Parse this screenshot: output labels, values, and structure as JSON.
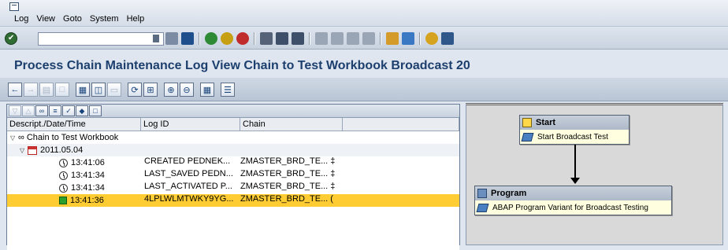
{
  "menu": [
    "Log",
    "View",
    "Goto",
    "System",
    "Help"
  ],
  "command_field": {
    "value": ""
  },
  "title": "Process Chain Maintenance Log View Chain to Test Workbook Broadcast 20",
  "table": {
    "headers": [
      "Descript./Date/Time",
      "Log ID",
      "Chain"
    ],
    "rows": [
      {
        "type": "chain",
        "c1": "Chain to Test Workbook",
        "c2": "",
        "c3": ""
      },
      {
        "type": "date",
        "c1": "2011.05.04",
        "c2": "",
        "c3": ""
      },
      {
        "type": "time",
        "c1": "13:41:06",
        "c2": "CREATED PEDNEK...",
        "c3": "ZMASTER_BRD_TE... ‡"
      },
      {
        "type": "time",
        "c1": "13:41:34",
        "c2": "LAST_SAVED PEDN...",
        "c3": "ZMASTER_BRD_TE... ‡"
      },
      {
        "type": "time",
        "c1": "13:41:34",
        "c2": "LAST_ACTIVATED P...",
        "c3": "ZMASTER_BRD_TE... ‡"
      },
      {
        "type": "selected",
        "c1": "13:41:36",
        "c2": "4LPLWLMTWKY9YG...",
        "c3": "ZMASTER_BRD_TE... ("
      }
    ]
  },
  "diagram": {
    "start": {
      "title": "Start",
      "label": "Start Broadcast Test"
    },
    "program": {
      "title": "Program",
      "label": "ABAP Program Variant for Broadcast Testing"
    }
  },
  "colors": {
    "title": "#1c3f6e",
    "selected_row": "#ffcc33",
    "node_body": "#ffffe0"
  },
  "icons": [
    "ok-icon",
    "save-icon",
    "back-icon",
    "exit-icon",
    "cancel-icon",
    "print-icon",
    "find-icon",
    "help-icon",
    "layout-icon",
    "chain-icon",
    "calendar-icon",
    "clock-icon",
    "status-green-icon"
  ]
}
